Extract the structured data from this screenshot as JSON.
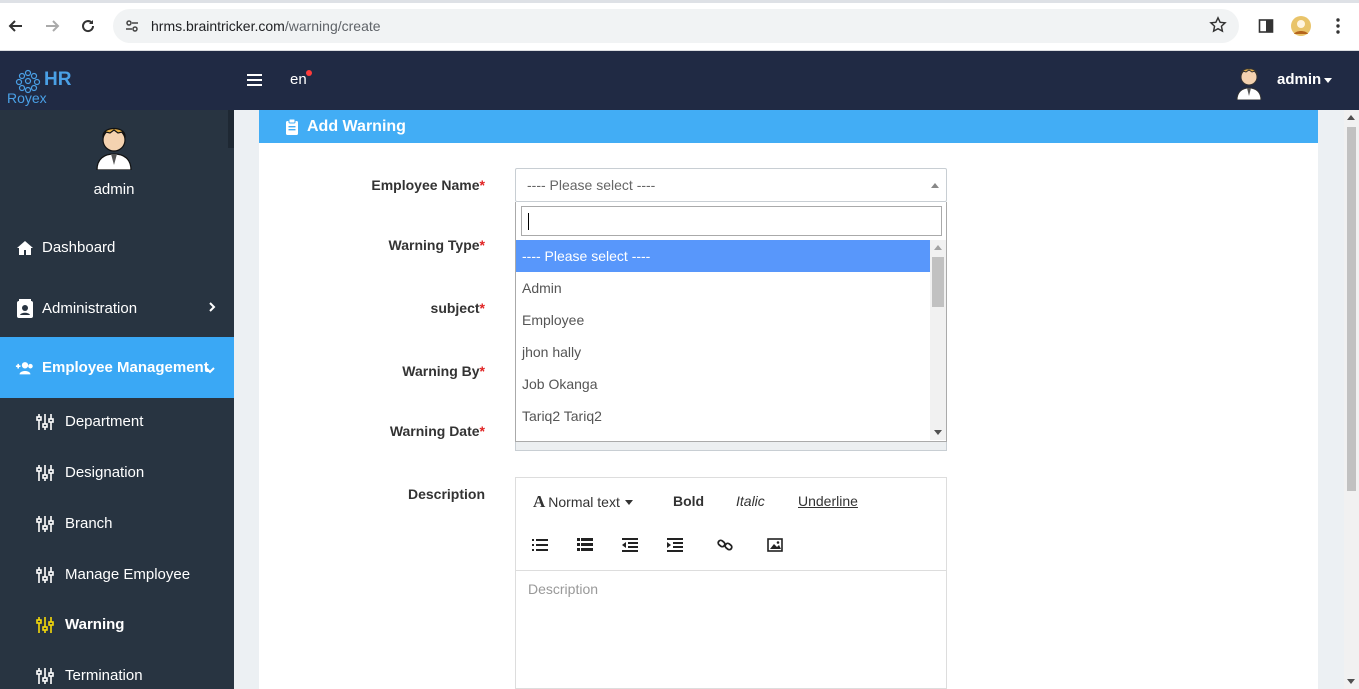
{
  "browser": {
    "url_host": "hrms.braintricker.com",
    "url_path": "/warning/create"
  },
  "topbar": {
    "logo_text_top": "HR",
    "logo_text_bottom": "Royex",
    "language": "en",
    "user_name": "admin"
  },
  "sidebar": {
    "user_name": "admin",
    "items": [
      {
        "label": "Dashboard",
        "icon": "home-icon"
      },
      {
        "label": "Administration",
        "icon": "contact-card-icon"
      },
      {
        "label": "Employee Management",
        "icon": "user-plus-icon"
      }
    ],
    "sub_items": [
      {
        "label": "Department"
      },
      {
        "label": "Designation"
      },
      {
        "label": "Branch"
      },
      {
        "label": "Manage Employee"
      },
      {
        "label": "Warning"
      },
      {
        "label": "Termination"
      }
    ],
    "colors": {
      "bg": "#283441",
      "active": "#3aa8f5",
      "current_icon": "#f5d90a"
    }
  },
  "form": {
    "header_title": "Add Warning",
    "labels": {
      "employee_name": "Employee Name",
      "warning_type": "Warning Type",
      "subject": "subject",
      "warning_by": "Warning By",
      "warning_date": "Warning Date",
      "description": "Description"
    },
    "required_mark": "*",
    "employee_select_value": "---- Please select ----",
    "dropdown_options": [
      "---- Please select ----",
      "Admin",
      "Employee",
      "jhon hally",
      "Job Okanga",
      "Tariq2 Tariq2"
    ],
    "editor": {
      "format_label": "Normal text",
      "bold": "Bold",
      "italic": "Italic",
      "underline": "Underline",
      "placeholder": "Description"
    }
  }
}
